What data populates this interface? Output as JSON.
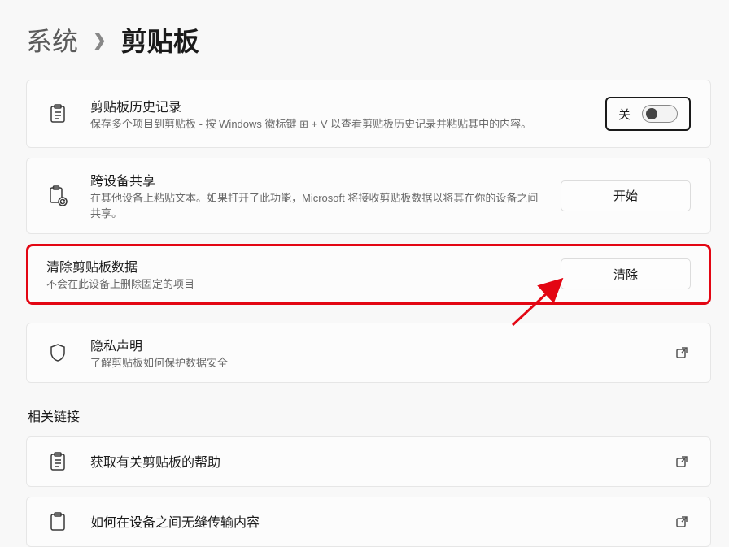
{
  "breadcrumb": {
    "parent": "系统",
    "current": "剪贴板"
  },
  "history": {
    "title": "剪贴板历史记录",
    "desc": "保存多个项目到剪贴板 - 按 Windows 徽标键 ⊞ + V 以查看剪贴板历史记录并粘贴其中的内容。",
    "toggle_state": "关"
  },
  "sync": {
    "title": "跨设备共享",
    "desc": "在其他设备上粘贴文本。如果打开了此功能，Microsoft 将接收剪贴板数据以将其在你的设备之间共享。",
    "button": "开始"
  },
  "clear": {
    "title": "清除剪贴板数据",
    "desc": "不会在此设备上删除固定的项目",
    "button": "清除"
  },
  "privacy": {
    "title": "隐私声明",
    "desc": "了解剪贴板如何保护数据安全"
  },
  "related_label": "相关链接",
  "related": {
    "help": "获取有关剪贴板的帮助",
    "transfer": "如何在设备之间无缝传输内容"
  }
}
